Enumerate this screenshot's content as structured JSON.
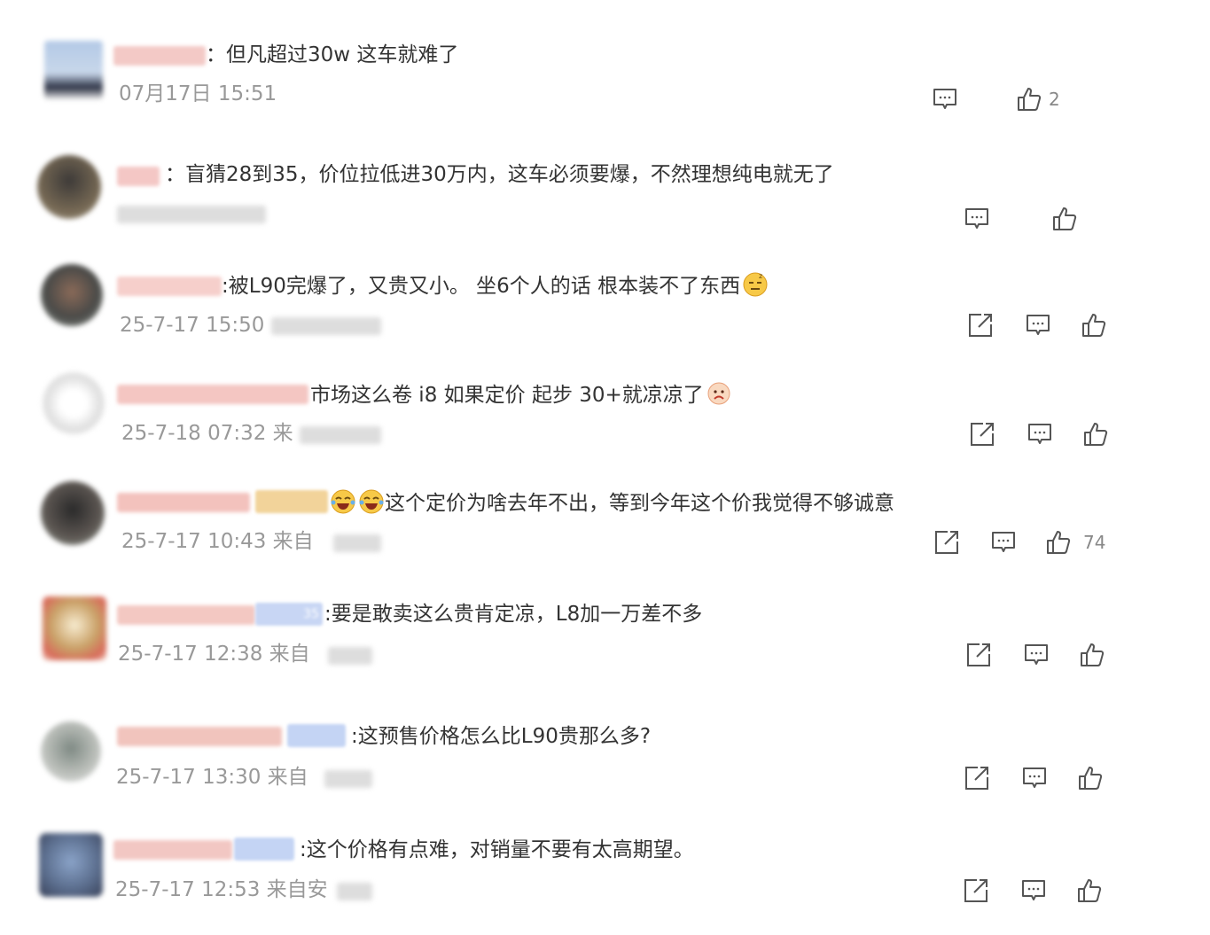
{
  "comments": [
    {
      "text": "：但凡超过30w 这车就难了",
      "meta": "07月17日 15:51",
      "like_count": "2",
      "colors": {
        "avatar": "#9fb8d8",
        "name": "#f3c9c6"
      }
    },
    {
      "text": "：盲猜28到35，价位拉低进30万内，这车必须要爆，不然理想纯电就无了",
      "meta": "",
      "like_count": "",
      "colors": {
        "avatar": "#6b6152",
        "name": "#f4c7c5"
      }
    },
    {
      "text": ":被L90完爆了，又贵又小。 坐6个人的话 根本装不了东西",
      "meta": "25-7-17 15:50",
      "like_count": "",
      "colors": {
        "avatar": "#6a5a4a",
        "name": "#f6cfcb"
      }
    },
    {
      "text": "市场这么卷 i8 如果定价 起步 30+就凉凉了",
      "meta": "25-7-18 07:32 来",
      "like_count": "",
      "colors": {
        "avatar": "#e4e4e4",
        "name": "#f4c6c2"
      }
    },
    {
      "text": "这个定价为啥去年不出，等到今年这个价我觉得不够诚意",
      "meta": "25-7-17 10:43 来自",
      "like_count": "74",
      "colors": {
        "avatar": "#3f3a38",
        "name": "#f3c2bd"
      }
    },
    {
      "text": ":要是敢卖这么贵肯定凉，L8加一万差不多",
      "meta": "25-7-17 12:38 来自",
      "like_count": "",
      "colors": {
        "avatar": "#c9a067",
        "name": "#f3c8c2"
      }
    },
    {
      "text": ":这预售价格怎么比L90贵那么多?",
      "meta": "25-7-17 13:30 来自",
      "like_count": "",
      "colors": {
        "avatar": "#a8aeaa",
        "name": "#f1c4bd"
      }
    },
    {
      "text": ":这个价格有点难，对销量不要有太高期望。",
      "meta": "25-7-17 12:53 来自安",
      "like_count": "",
      "colors": {
        "avatar": "#5d7090",
        "name": "#f2c7c3"
      }
    }
  ],
  "badge_text": "35",
  "icons": {
    "share": "share-icon",
    "reply": "comment-icon",
    "like": "thumbs-up-icon"
  }
}
